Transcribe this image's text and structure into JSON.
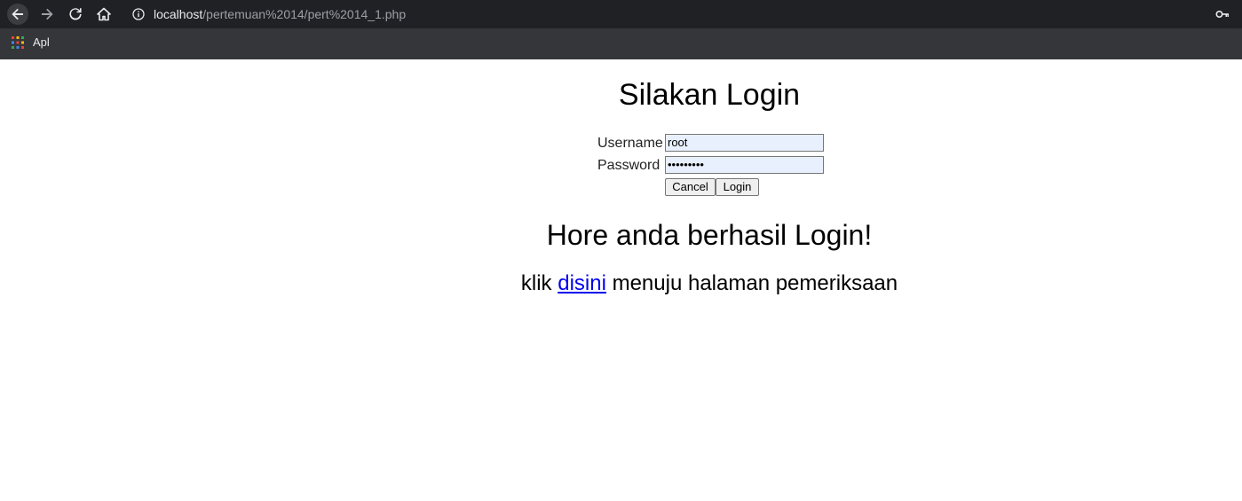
{
  "browser": {
    "url_host": "localhost",
    "url_path": "/pertemuan%2014/pert%2014_1.php",
    "bookmarks": [
      {
        "label": "Apl",
        "icon": "apps-grid-icon"
      }
    ],
    "icons": {
      "back": "back-arrow-icon",
      "forward": "forward-arrow-icon",
      "reload": "reload-icon",
      "home": "home-icon",
      "site_info": "info-icon",
      "password": "key-icon"
    },
    "colors": {
      "toolbar": "#202124",
      "bookmarks_bar": "#35363a"
    }
  },
  "page": {
    "title": "Silakan Login",
    "form": {
      "username_label": "Username",
      "username_value": "root",
      "password_label": "Password",
      "password_mask": "•••••••••",
      "cancel_label": "Cancel",
      "login_label": "Login",
      "autofill_color": "#e8f0fe"
    },
    "success_message": "Hore anda berhasil Login!",
    "note_prefix": "klik",
    "note_link": "disini",
    "note_suffix": "menuju halaman pemeriksaan",
    "link_color": "#0000ee"
  }
}
